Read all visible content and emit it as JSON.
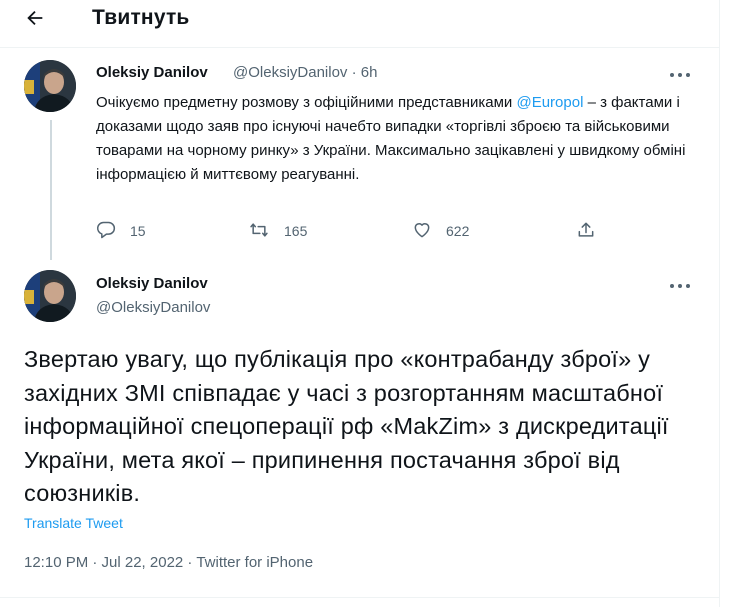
{
  "header": {
    "title": "Твитнуть"
  },
  "reply_tweet": {
    "author_name": "Oleksiy Danilov",
    "author_meta": "@OleksiyDanilov · 6h",
    "text_before_mention": "Очікуємо предметну розмову з офіційними представниками ",
    "mention": "@Europol",
    "text_after_mention": " – з фактами і доказами щодо заяв про існуючі начебто випадки «торгівлі зброєю та військовими товарами на чорному ринку» з України. Максимально зацікавлені у швидкому обміні інформацією й миттєвому реагуванні.",
    "reply_count": "15",
    "retweet_count": "165",
    "like_count": "622"
  },
  "main_tweet": {
    "author_name": "Oleksiy Danilov",
    "author_handle": "@OleksiyDanilov",
    "text": "Звертаю увагу, що публікація про «контрабанду зброї» у західних ЗМІ співпадає у часі з розгортанням масштабної інформаційної спецоперації рф «MakZim» з дискредитації України, мета якої – припинення постачання зброї від союзників.",
    "translate_label": "Translate Tweet",
    "meta": "12:10 PM · Jul 22, 2022 · Twitter for iPhone"
  },
  "colors": {
    "accent": "#1d9bf0",
    "secondary_text": "#536471",
    "primary_text": "#0f1419"
  },
  "icons": [
    "back-arrow-icon",
    "more-icon",
    "reply-icon",
    "retweet-icon",
    "like-icon",
    "share-icon"
  ]
}
